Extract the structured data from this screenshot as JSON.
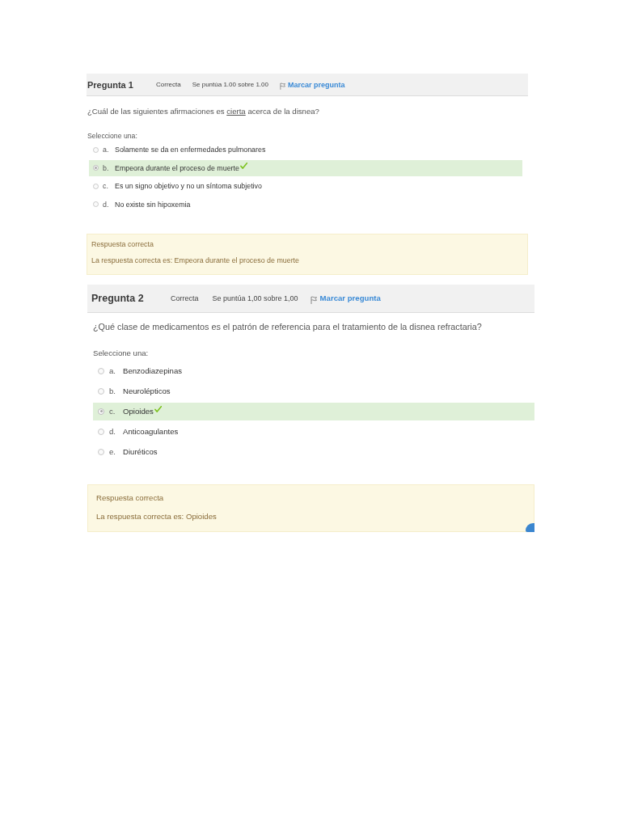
{
  "questions": [
    {
      "title": "Pregunta 1",
      "status": "Correcta",
      "grade": "Se puntúa 1.00 sobre 1.00",
      "flag_link": "Marcar pregunta",
      "prompt": [
        {
          "text": "¿Cuál de las siguientes afirmaciones es ",
          "underlined": false
        },
        {
          "text": "cierta",
          "underlined": true
        },
        {
          "text": " acerca de la disnea?",
          "underlined": false
        }
      ],
      "instruction": "Seleccione una:",
      "options": [
        {
          "letter": "a.",
          "text": "Solamente se da en enfermedades pulmonares",
          "selected": false,
          "correct": false
        },
        {
          "letter": "b.",
          "text": "Empeora durante el proceso de muerte",
          "selected": true,
          "correct": true
        },
        {
          "letter": "c.",
          "text": "Es un signo objetivo y no un síntoma subjetivo",
          "selected": false,
          "correct": false
        },
        {
          "letter": "d.",
          "text": "No existe sin hipoxemia",
          "selected": false,
          "correct": false
        }
      ],
      "feedback": {
        "title": "Respuesta correcta",
        "answer": "La respuesta correcta es: Empeora durante el proceso de muerte"
      }
    },
    {
      "title": "Pregunta 2",
      "status": "Correcta",
      "grade": "Se puntúa 1,00 sobre 1,00",
      "flag_link": "Marcar pregunta",
      "prompt": [
        {
          "text": "¿Qué clase de medicamentos es el patrón de referencia para el tratamiento de la disnea refractaria?",
          "underlined": false
        }
      ],
      "instruction": "Seleccione una:",
      "options": [
        {
          "letter": "a.",
          "text": "Benzodiazepinas",
          "selected": false,
          "correct": false
        },
        {
          "letter": "b.",
          "text": "Neurolépticos",
          "selected": false,
          "correct": false
        },
        {
          "letter": "c.",
          "text": "Opioides",
          "selected": true,
          "correct": true
        },
        {
          "letter": "d.",
          "text": "Anticoagulantes",
          "selected": false,
          "correct": false
        },
        {
          "letter": "e.",
          "text": "Diuréticos",
          "selected": false,
          "correct": false
        }
      ],
      "feedback": {
        "title": "Respuesta correcta",
        "answer": "La respuesta correcta es: Opioides"
      }
    }
  ]
}
